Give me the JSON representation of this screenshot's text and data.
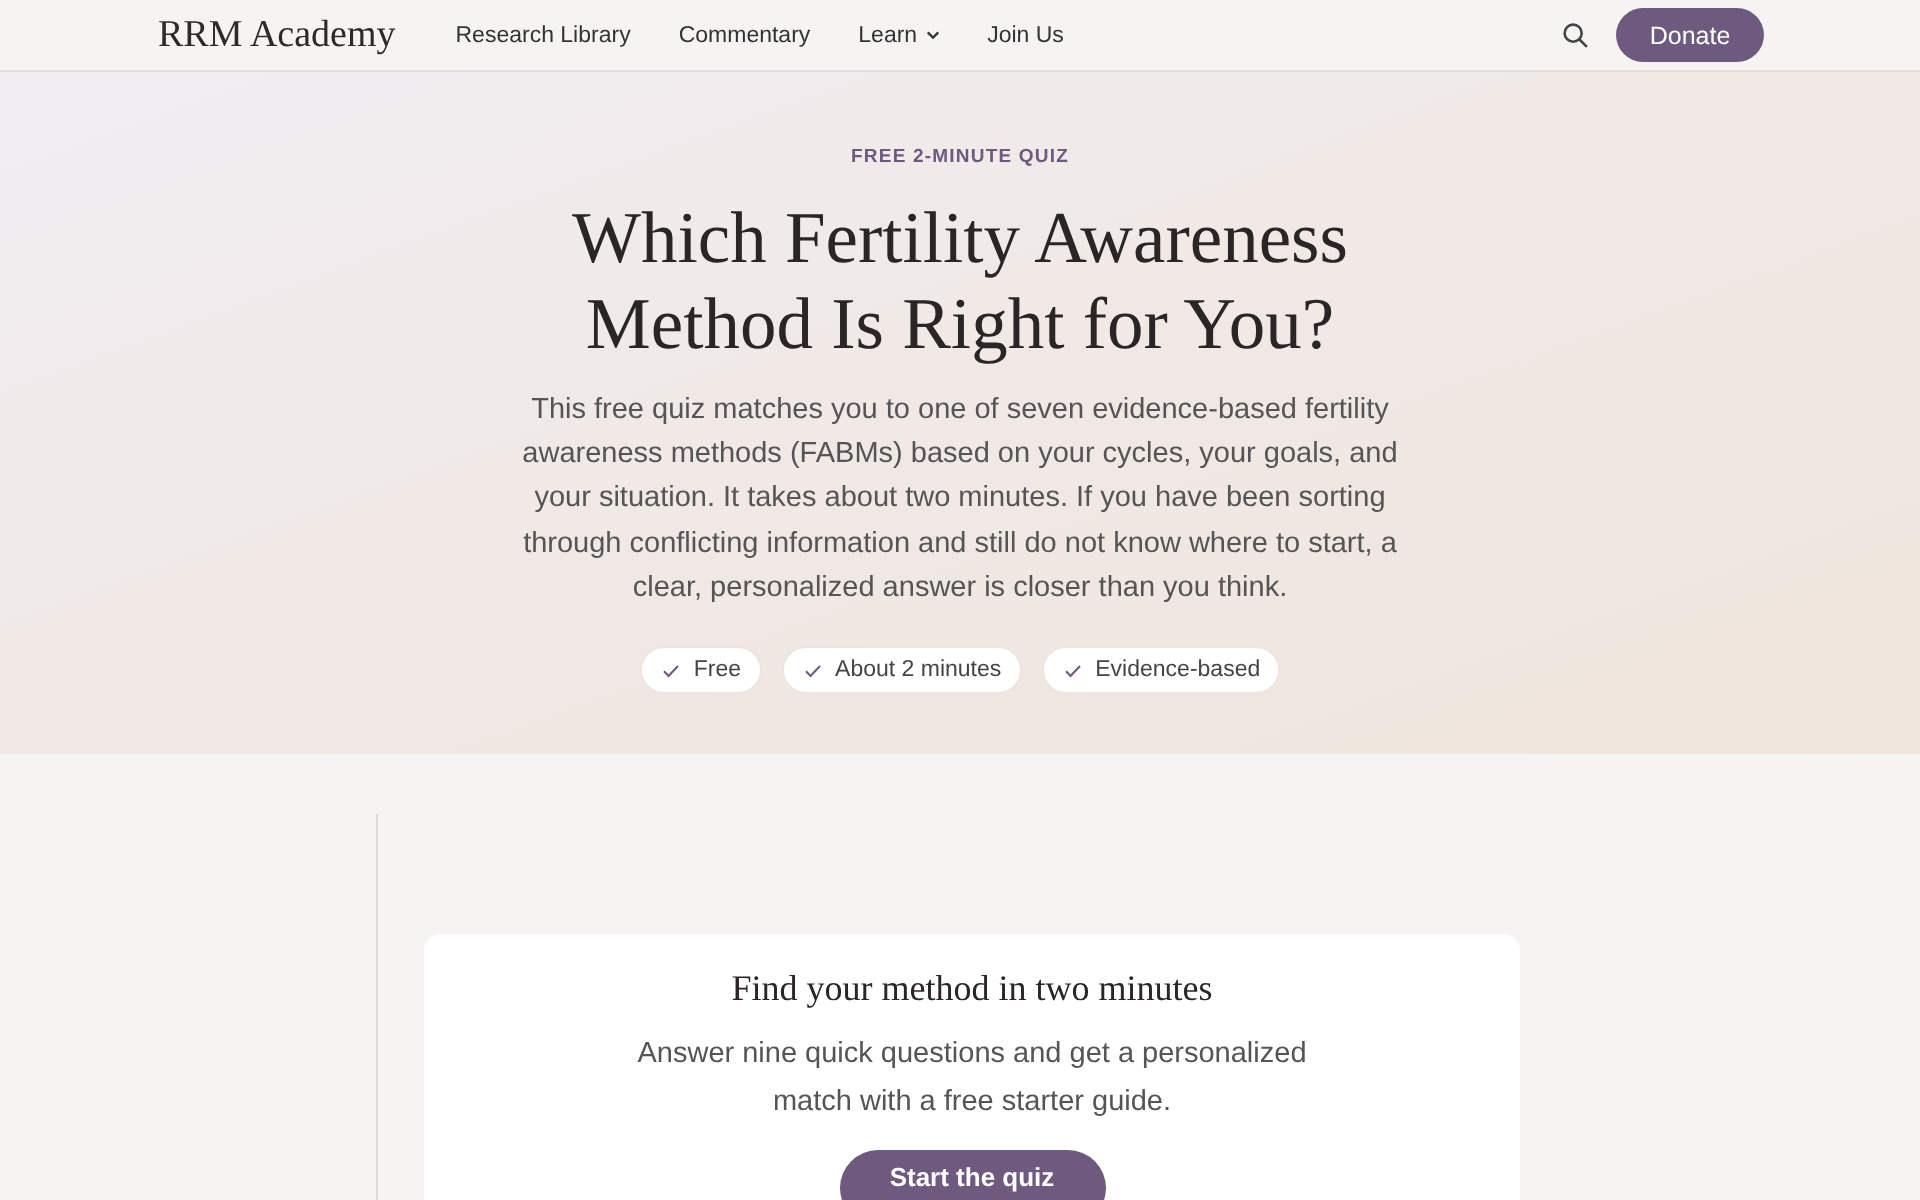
{
  "nav": {
    "logo": "RRM Academy",
    "links": [
      {
        "label": "Research Library",
        "dropdown": false
      },
      {
        "label": "Commentary",
        "dropdown": false
      },
      {
        "label": "Learn",
        "dropdown": true
      },
      {
        "label": "Join Us",
        "dropdown": false
      }
    ],
    "donate": "Donate"
  },
  "hero": {
    "eyebrow": "FREE 2-MINUTE QUIZ",
    "title": "Which Fertility Awareness Method Is Right for You?",
    "intro": "This free quiz matches you to one of seven evidence-based fertility awareness methods (FABMs) based on your cycles, your goals, and your situation. It takes about two minutes. If you have been sorting through conflicting information and still do not know where to start, a clear, personalized answer is closer than you think.",
    "chips": [
      "Free",
      "About 2 minutes",
      "Evidence-based"
    ]
  },
  "quiz_card": {
    "title": "Find your method in two minutes",
    "text": "Answer nine quick questions and get a personalized match with a free starter guide.",
    "button": "Start the quiz"
  }
}
